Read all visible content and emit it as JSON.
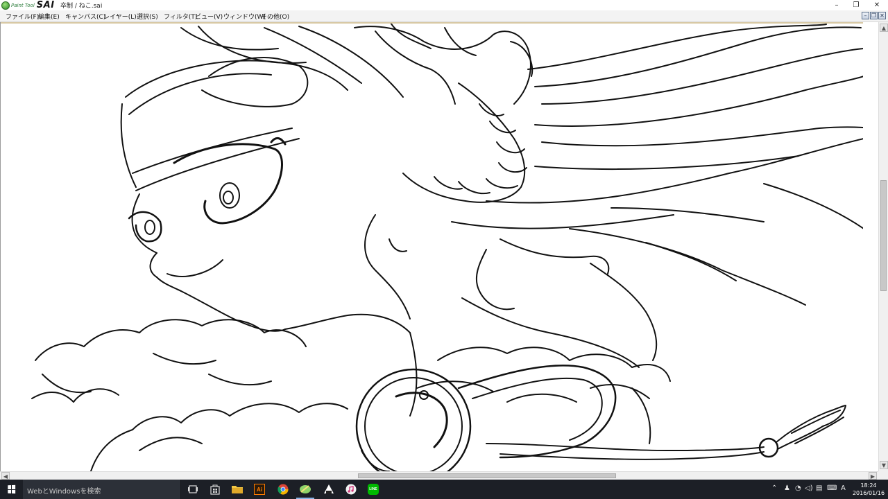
{
  "app": {
    "logo_small": "Paint Tool",
    "logo_big": "SAI",
    "document_title": "卒制 / ねこ.sai"
  },
  "window_controls": {
    "minimize": "–",
    "restore": "❐",
    "close": "✕"
  },
  "child_controls": {
    "minimize": "–",
    "restore": "❐",
    "close": "✕"
  },
  "menu": {
    "items": [
      {
        "label": "ファイル(F)"
      },
      {
        "label": "編集(E)"
      },
      {
        "label": "キャンバス(C)"
      },
      {
        "label": "レイヤー(L)"
      },
      {
        "label": "選択(S)"
      },
      {
        "label": "フィルタ(T)"
      },
      {
        "label": "ビュー(V)"
      },
      {
        "label": "ウィンドウ(W)"
      },
      {
        "label": "その他(O)"
      }
    ]
  },
  "canvas": {
    "content": "line-art-cat-girl-illustration"
  },
  "taskbar": {
    "search_placeholder": "WebとWindowsを検索",
    "apps": [
      {
        "icon": "task-view-icon"
      },
      {
        "icon": "store-icon"
      },
      {
        "icon": "file-explorer-icon"
      },
      {
        "icon": "illustrator-icon",
        "label": "Ai"
      },
      {
        "icon": "chrome-icon"
      },
      {
        "icon": "paint-tool-sai-icon"
      },
      {
        "icon": "onigiri-app-icon"
      },
      {
        "icon": "itunes-icon"
      },
      {
        "icon": "line-app-icon",
        "label": "LINE"
      }
    ],
    "clock_time": "18:24",
    "clock_date": "2016/01/16",
    "colors": {
      "taskbar_bg": "#1c1f26",
      "illustrator": "#ff7c00",
      "line": "#00b900"
    }
  }
}
